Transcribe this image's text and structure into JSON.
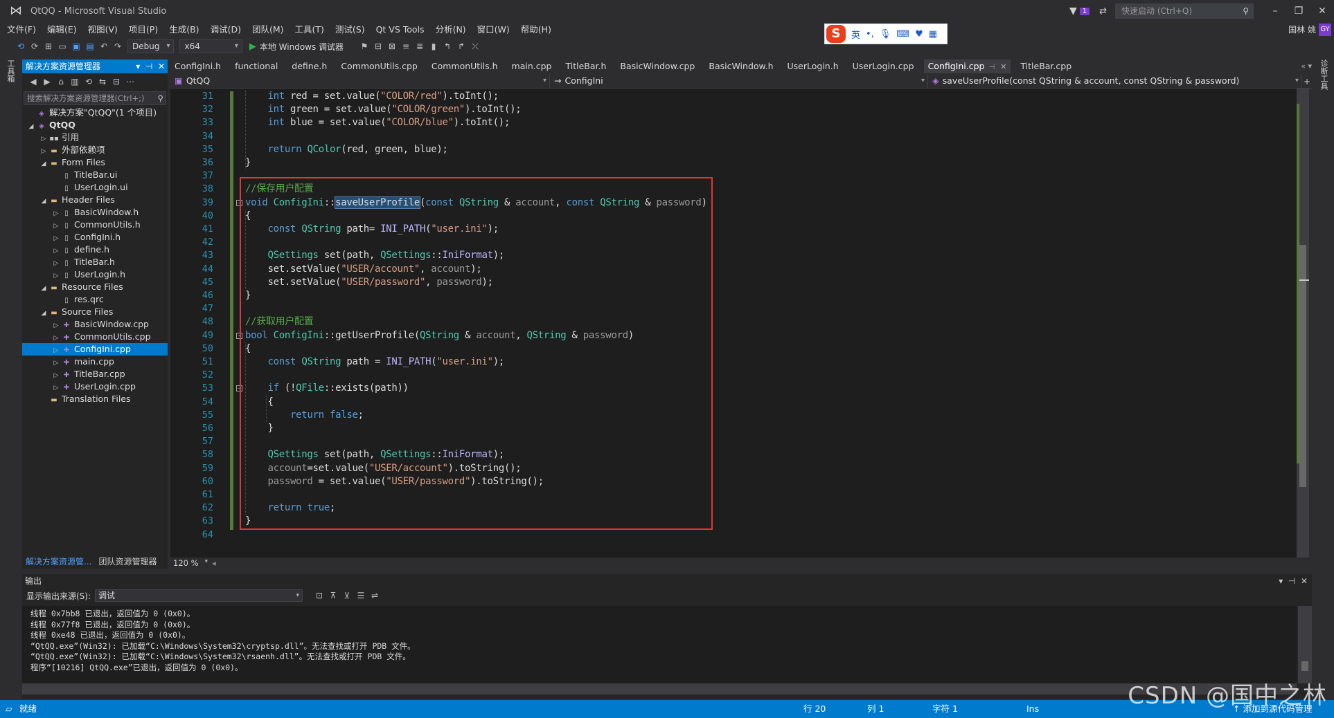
{
  "window": {
    "title": "QtQQ - Microsoft Visual Studio",
    "notif_count": "1",
    "quick_launch_placeholder": "快速启动 (Ctrl+Q)"
  },
  "menu": [
    "文件(F)",
    "编辑(E)",
    "视图(V)",
    "项目(P)",
    "生成(B)",
    "调试(D)",
    "团队(M)",
    "工具(T)",
    "测试(S)",
    "Qt VS Tools",
    "分析(N)",
    "窗口(W)",
    "帮助(H)"
  ],
  "user": {
    "name": "国林 姚",
    "badge": "GY"
  },
  "ime": {
    "lang": "英"
  },
  "toolbar": {
    "config": "Debug",
    "platform": "x64",
    "run_label": "本地 Windows 调试器"
  },
  "side_labels": {
    "left": "工具箱",
    "right": "诊断工具"
  },
  "solution_explorer": {
    "title": "解决方案资源管理器",
    "search_placeholder": "搜索解决方案资源管理器(Ctrl+;)",
    "tree": [
      {
        "label": "解决方案\"QtQQ\"(1 个项目)",
        "level": 0,
        "arrow": "",
        "icon": "sln"
      },
      {
        "label": "QtQQ",
        "level": 0,
        "arrow": "◢",
        "icon": "proj",
        "bold": true
      },
      {
        "label": "引用",
        "level": 1,
        "arrow": "▷",
        "icon": "ref"
      },
      {
        "label": "外部依赖项",
        "level": 1,
        "arrow": "▷",
        "icon": "folder"
      },
      {
        "label": "Form Files",
        "level": 1,
        "arrow": "◢",
        "icon": "folder"
      },
      {
        "label": "TitleBar.ui",
        "level": 2,
        "arrow": "",
        "icon": "file"
      },
      {
        "label": "UserLogin.ui",
        "level": 2,
        "arrow": "",
        "icon": "file"
      },
      {
        "label": "Header Files",
        "level": 1,
        "arrow": "◢",
        "icon": "folder"
      },
      {
        "label": "BasicWindow.h",
        "level": 2,
        "arrow": "▷",
        "icon": "file"
      },
      {
        "label": "CommonUtils.h",
        "level": 2,
        "arrow": "▷",
        "icon": "file"
      },
      {
        "label": "ConfigIni.h",
        "level": 2,
        "arrow": "▷",
        "icon": "file"
      },
      {
        "label": "define.h",
        "level": 2,
        "arrow": "▷",
        "icon": "file"
      },
      {
        "label": "TitleBar.h",
        "level": 2,
        "arrow": "▷",
        "icon": "file"
      },
      {
        "label": "UserLogin.h",
        "level": 2,
        "arrow": "▷",
        "icon": "file"
      },
      {
        "label": "Resource Files",
        "level": 1,
        "arrow": "◢",
        "icon": "folder"
      },
      {
        "label": "res.qrc",
        "level": 2,
        "arrow": "",
        "icon": "file"
      },
      {
        "label": "Source Files",
        "level": 1,
        "arrow": "◢",
        "icon": "folder"
      },
      {
        "label": "BasicWindow.cpp",
        "level": 2,
        "arrow": "▷",
        "icon": "cpp"
      },
      {
        "label": "CommonUtils.cpp",
        "level": 2,
        "arrow": "▷",
        "icon": "cpp"
      },
      {
        "label": "ConfigIni.cpp",
        "level": 2,
        "arrow": "▷",
        "icon": "cpp",
        "selected": true
      },
      {
        "label": "main.cpp",
        "level": 2,
        "arrow": "▷",
        "icon": "cpp"
      },
      {
        "label": "TitleBar.cpp",
        "level": 2,
        "arrow": "▷",
        "icon": "cpp"
      },
      {
        "label": "UserLogin.cpp",
        "level": 2,
        "arrow": "▷",
        "icon": "cpp"
      },
      {
        "label": "Translation Files",
        "level": 1,
        "arrow": "",
        "icon": "folder"
      }
    ],
    "bottom_tabs": [
      "解决方案资源管...",
      "团队资源管理器"
    ]
  },
  "tabs": [
    {
      "label": "ConfigIni.h"
    },
    {
      "label": "functional"
    },
    {
      "label": "define.h"
    },
    {
      "label": "CommonUtils.cpp"
    },
    {
      "label": "CommonUtils.h"
    },
    {
      "label": "main.cpp"
    },
    {
      "label": "TitleBar.h"
    },
    {
      "label": "BasicWindow.cpp"
    },
    {
      "label": "BasicWindow.h"
    },
    {
      "label": "UserLogin.h"
    },
    {
      "label": "UserLogin.cpp"
    },
    {
      "label": "ConfigIni.cpp",
      "active": true
    },
    {
      "label": "TitleBar.cpp"
    }
  ],
  "nav": {
    "project": "QtQQ",
    "scope": "ConfigIni",
    "member": "saveUserProfile(const QString & account, const QString & password)"
  },
  "code_lines": [
    {
      "n": "31",
      "html": "    <span class=\"k\">int</span> red = set.value(<span class=\"s\">\"COLOR/red\"</span>).toInt();"
    },
    {
      "n": "32",
      "html": "    <span class=\"k\">int</span> green = set.value(<span class=\"s\">\"COLOR/green\"</span>).toInt();"
    },
    {
      "n": "33",
      "html": "    <span class=\"k\">int</span> blue = set.value(<span class=\"s\">\"COLOR/blue\"</span>).toInt();"
    },
    {
      "n": "34",
      "html": ""
    },
    {
      "n": "35",
      "html": "    <span class=\"k\">return</span> <span class=\"t\">QColor</span>(red, green, blue);"
    },
    {
      "n": "36",
      "html": "}"
    },
    {
      "n": "37",
      "html": ""
    },
    {
      "n": "38",
      "html": "<span class=\"c\">//保存用户配置</span>"
    },
    {
      "n": "39",
      "html": "<span class=\"k\">void</span> <span class=\"t\">ConfigIni</span>::<span class=\"hl\">saveUserProfile</span>(<span class=\"k\">const</span> <span class=\"t\">QString</span> &amp; <span class=\"p\">account</span>, <span class=\"k\">const</span> <span class=\"t\">QString</span> &amp; <span class=\"p\">password</span>)"
    },
    {
      "n": "40",
      "html": "{"
    },
    {
      "n": "41",
      "html": "    <span class=\"k\">const</span> <span class=\"t\">QString</span> path= <span class=\"m\">INI_PATH</span>(<span class=\"s\">\"user.ini\"</span>);"
    },
    {
      "n": "42",
      "html": ""
    },
    {
      "n": "43",
      "html": "    <span class=\"t\">QSettings</span> set(path, <span class=\"t\">QSettings</span>::<span class=\"m\">IniFormat</span>);"
    },
    {
      "n": "44",
      "html": "    set.setValue(<span class=\"s\">\"USER/account\"</span>, <span class=\"p\">account</span>);"
    },
    {
      "n": "45",
      "html": "    set.setValue(<span class=\"s\">\"USER/password\"</span>, <span class=\"p\">password</span>);"
    },
    {
      "n": "46",
      "html": "}"
    },
    {
      "n": "47",
      "html": ""
    },
    {
      "n": "48",
      "html": "<span class=\"c\">//获取用户配置</span>"
    },
    {
      "n": "49",
      "html": "<span class=\"k\">bool</span> <span class=\"t\">ConfigIni</span>::getUserProfile(<span class=\"t\">QString</span> &amp; <span class=\"p\">account</span>, <span class=\"t\">QString</span> &amp; <span class=\"p\">password</span>)"
    },
    {
      "n": "50",
      "html": "{"
    },
    {
      "n": "51",
      "html": "    <span class=\"k\">const</span> <span class=\"t\">QString</span> path = <span class=\"m\">INI_PATH</span>(<span class=\"s\">\"user.ini\"</span>);"
    },
    {
      "n": "52",
      "html": ""
    },
    {
      "n": "53",
      "html": "    <span class=\"k\">if</span> (!<span class=\"t\">QFile</span>::exists(path))"
    },
    {
      "n": "54",
      "html": "    {"
    },
    {
      "n": "55",
      "html": "        <span class=\"k\">return</span> <span class=\"k\">false</span>;"
    },
    {
      "n": "56",
      "html": "    }"
    },
    {
      "n": "57",
      "html": ""
    },
    {
      "n": "58",
      "html": "    <span class=\"t\">QSettings</span> set(path, <span class=\"t\">QSettings</span>::<span class=\"m\">IniFormat</span>);"
    },
    {
      "n": "59",
      "html": "    <span class=\"p\">account</span>=set.value(<span class=\"s\">\"USER/account\"</span>).toString();"
    },
    {
      "n": "60",
      "html": "    <span class=\"p\">password</span> = set.value(<span class=\"s\">\"USER/password\"</span>).toString();"
    },
    {
      "n": "61",
      "html": ""
    },
    {
      "n": "62",
      "html": "    <span class=\"k\">return</span> <span class=\"k\">true</span>;"
    },
    {
      "n": "63",
      "html": "}"
    },
    {
      "n": "64",
      "html": ""
    }
  ],
  "zoom": "120 %",
  "output": {
    "title": "输出",
    "source_label": "显示输出来源(S):",
    "source_value": "调试",
    "lines": [
      "线程 0x7bb8 已退出，返回值为 0 (0x0)。",
      "线程 0x77f8 已退出，返回值为 0 (0x0)。",
      "线程 0xe48 已退出，返回值为 0 (0x0)。",
      "“QtQQ.exe”(Win32): 已加载“C:\\Windows\\System32\\cryptsp.dll”。无法查找或打开 PDB 文件。",
      "“QtQQ.exe”(Win32): 已加载“C:\\Windows\\System32\\rsaenh.dll”。无法查找或打开 PDB 文件。",
      "程序“[10216] QtQQ.exe”已退出，返回值为 0 (0x0)。"
    ]
  },
  "status": {
    "ready": "就绪",
    "line": "行 20",
    "col": "列 1",
    "char": "字符 1",
    "ins": "Ins",
    "source_control": "↑ 添加到源代码管理"
  },
  "watermark": "CSDN @国中之林"
}
